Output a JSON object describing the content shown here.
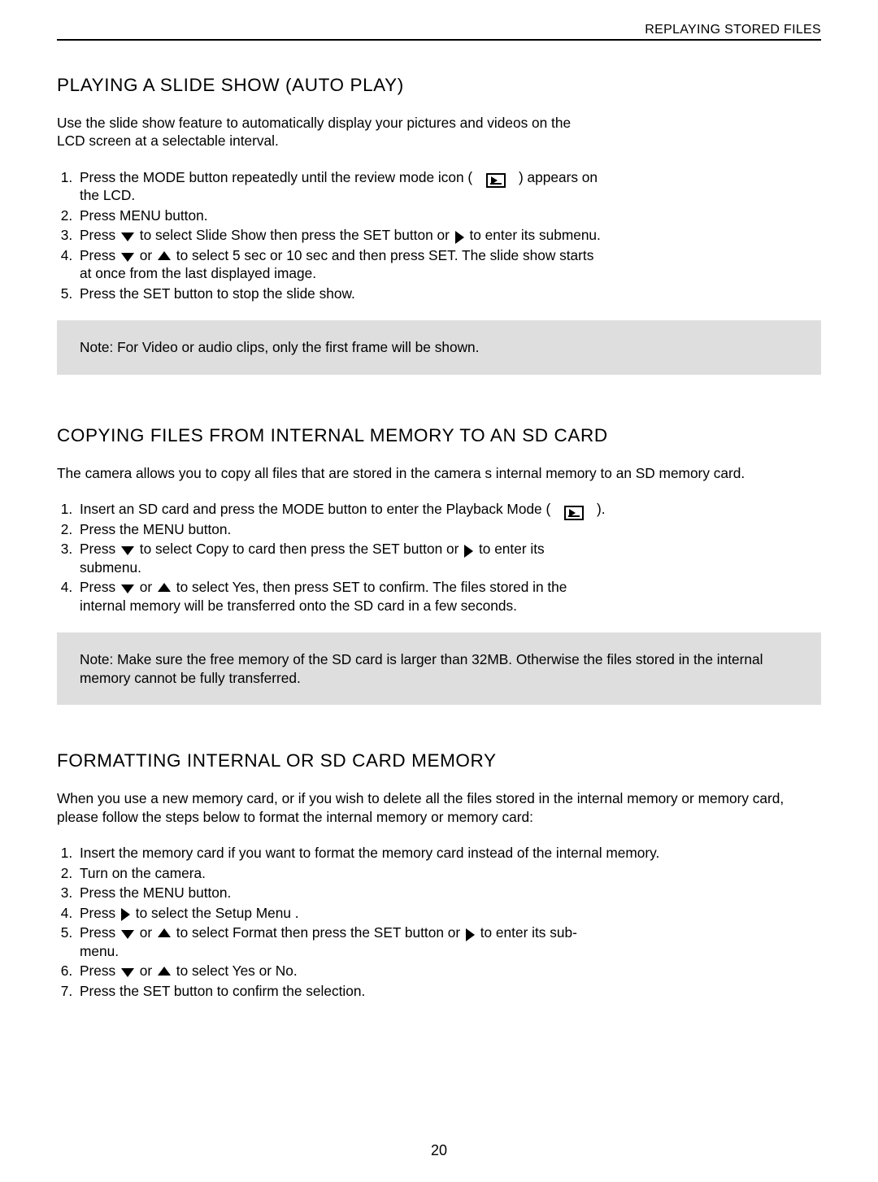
{
  "header": "REPLAYING STORED FILES",
  "page_number": "20",
  "sections": {
    "slideshow": {
      "title": "PLAYING A SLIDE SHOW (AUTO PLAY)",
      "intro": "Use the slide show feature to automatically display your pictures and videos on the LCD screen at a selectable interval.",
      "steps": {
        "s1a": "Press the MODE button repeatedly until the review mode icon (  ",
        "s1b": "  ) appears on the LCD.",
        "s2": "Press MENU button.",
        "s3a": "Press ",
        "s3b": " to select Slide Show then press the SET button or ",
        "s3c": " to enter its submenu.",
        "s4a": "Press ",
        "s4b": " or ",
        "s4c": " to select 5 sec or 10 sec and then press SET. The slide show starts at once from the last displayed image.",
        "s5": "Press the SET button to stop the slide show."
      },
      "note": "Note: For Video or audio clips, only the first frame will be shown."
    },
    "copying": {
      "title": "COPYING FILES FROM INTERNAL MEMORY TO AN SD CARD",
      "intro": "The camera allows you to copy all files that are stored in the camera s internal memory to an SD memory card.",
      "steps": {
        "s1a": "Insert an SD card and press the MODE button to enter the Playback Mode (  ",
        "s1b": "  ).",
        "s2": "Press the MENU button.",
        "s3a": "Press ",
        "s3b": " to select Copy to card  then press the SET button or ",
        "s3c": " to enter its submenu.",
        "s4a": "Press ",
        "s4b": " or ",
        "s4c": " to select Yes, then press SET to confirm. The files stored in the internal memory will be transferred onto the SD card in a few seconds."
      },
      "note": "Note: Make sure the free memory of the SD card is larger than 32MB. Otherwise the files stored in the internal memory cannot be fully transferred."
    },
    "formatting": {
      "title": "FORMATTING INTERNAL OR SD CARD MEMORY",
      "intro": "When you use a new memory card, or if you wish to delete all the files stored in the internal memory or memory card, please follow the steps below to format the internal memory or memory card:",
      "steps": {
        "s1": "Insert the memory card if you want to format the memory card instead of the internal memory.",
        "s2": "Turn on the camera.",
        "s3": "Press the MENU button.",
        "s4a": "Press ",
        "s4b": " to select the Setup Menu .",
        "s5a": "Press ",
        "s5b": " or ",
        "s5c": " to select Format  then press the SET button or ",
        "s5d": " to enter its sub-menu.",
        "s6a": "Press ",
        "s6b": " or ",
        "s6c": " to select Yes or No.",
        "s7": "Press the SET button to confirm the selection."
      }
    }
  }
}
